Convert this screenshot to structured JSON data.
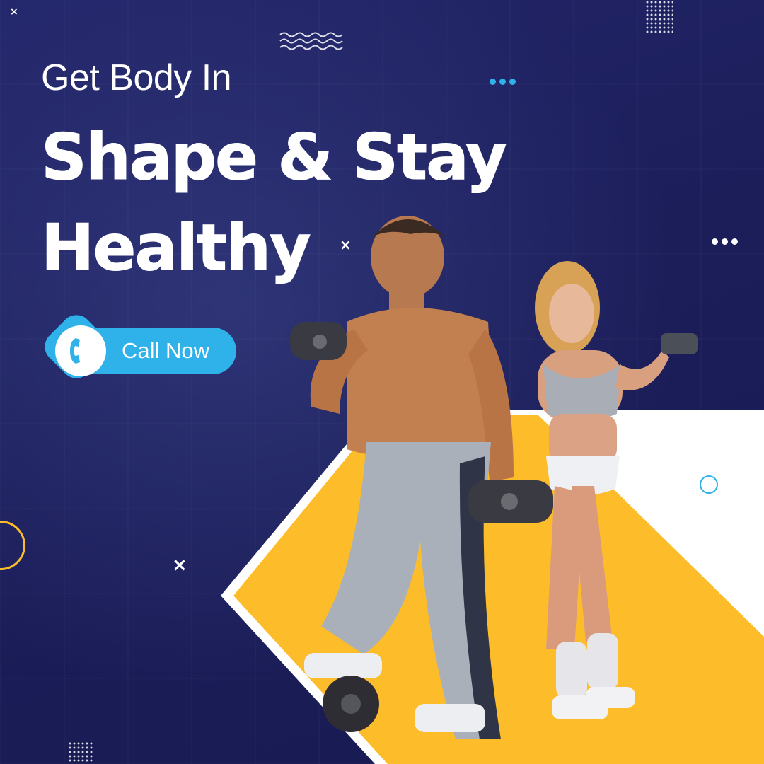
{
  "headline": {
    "small": "Get Body In",
    "line1": "Shape & Stay",
    "line2": "Healthy"
  },
  "cta": {
    "label": "Call Now",
    "icon": "phone-icon"
  },
  "colors": {
    "background": "#1b1d57",
    "accent_blue": "#2fb2ea",
    "accent_yellow": "#fdbd2b",
    "text": "#ffffff"
  }
}
